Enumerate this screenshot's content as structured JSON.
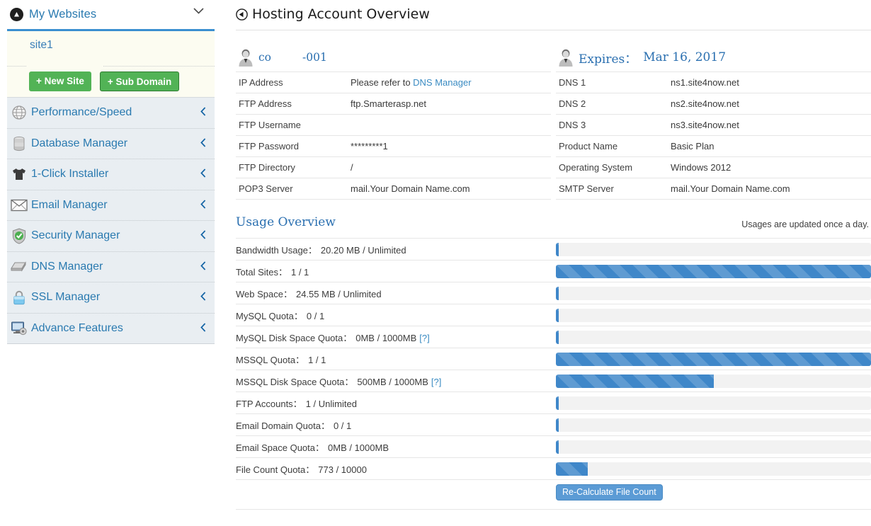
{
  "sidebar": {
    "header": {
      "title": "My Websites",
      "logo_icon": "triangle-circle-logo",
      "collapse_icon": "chevron-down-icon"
    },
    "site": {
      "name": "site1"
    },
    "buttons": [
      {
        "label": "+ New Site",
        "name": "new-site-button"
      },
      {
        "label": "+ Sub Domain",
        "name": "sub-domain-button"
      }
    ],
    "items": [
      {
        "label": "Performance/Speed",
        "icon": "globe-icon"
      },
      {
        "label": "Database Manager",
        "icon": "database-icon"
      },
      {
        "label": "1-Click Installer",
        "icon": "shirt-icon"
      },
      {
        "label": "Email Manager",
        "icon": "envelope-icon"
      },
      {
        "label": "Security Manager",
        "icon": "shield-check-icon"
      },
      {
        "label": "DNS Manager",
        "icon": "tray-icon"
      },
      {
        "label": "SSL Manager",
        "icon": "lock-icon"
      },
      {
        "label": "Advance Features",
        "icon": "monitor-gear-icon"
      }
    ],
    "caret_icon": "chevron-left-icon"
  },
  "main": {
    "page_title": "Hosting Account Overview",
    "back_icon": "circle-left-arrow-icon",
    "account": {
      "person_icon": "user-avatar-icon",
      "name_prefix": "co",
      "name_suffix": "-001"
    },
    "expires": {
      "person_icon": "user-avatar-icon",
      "label": "Expires：",
      "value": "Mar 16, 2017"
    },
    "left_table": [
      {
        "key": "IP Address",
        "value": "Please refer to ",
        "link": "DNS Manager"
      },
      {
        "key": "FTP Address",
        "value": "ftp.Smarterasp.net"
      },
      {
        "key": "FTP Username",
        "value": ""
      },
      {
        "key": "FTP Password",
        "value": "*********1"
      },
      {
        "key": "FTP Directory",
        "value": "/"
      },
      {
        "key": "POP3 Server",
        "value": "mail.Your Domain Name.com"
      }
    ],
    "right_table": [
      {
        "key": "DNS 1",
        "value": "ns1.site4now.net"
      },
      {
        "key": "DNS 2",
        "value": "ns2.site4now.net"
      },
      {
        "key": "DNS 3",
        "value": "ns3.site4now.net"
      },
      {
        "key": "Product Name",
        "value": "Basic Plan"
      },
      {
        "key": "Operating System",
        "value": "Windows 2012"
      },
      {
        "key": "SMTP Server",
        "value": "mail.Your Domain Name.com"
      }
    ],
    "usage": {
      "title": "Usage Overview",
      "note": "Usages are updated once a day.",
      "rows": [
        {
          "label": "Bandwidth Usage：",
          "value": "20.20 MB / Unlimited",
          "percent": 1,
          "help": ""
        },
        {
          "label": "Total Sites：",
          "value": "1 / 1",
          "percent": 100,
          "help": ""
        },
        {
          "label": "Web Space：",
          "value": "24.55 MB / Unlimited",
          "percent": 1,
          "help": ""
        },
        {
          "label": "MySQL Quota：",
          "value": "0 / 1",
          "percent": 1,
          "help": ""
        },
        {
          "label": "MySQL Disk Space Quota：",
          "value": "0MB / 1000MB",
          "percent": 1,
          "help": "[?]"
        },
        {
          "label": "MSSQL Quota：",
          "value": "1 / 1",
          "percent": 100,
          "help": ""
        },
        {
          "label": "MSSQL Disk Space Quota：",
          "value": "500MB / 1000MB",
          "percent": 50,
          "help": "[?]"
        },
        {
          "label": "FTP Accounts：",
          "value": "1 / Unlimited",
          "percent": 1,
          "help": ""
        },
        {
          "label": "Email Domain Quota：",
          "value": "0 / 1",
          "percent": 1,
          "help": ""
        },
        {
          "label": "Email Space Quota：",
          "value": "0MB / 1000MB",
          "percent": 1,
          "help": ""
        },
        {
          "label": "File Count Quota：",
          "value": "773 / 10000",
          "percent": 10,
          "help": ""
        }
      ],
      "recalc_label": "Re-Calculate File Count"
    }
  },
  "colors": {
    "accent_blue": "#2a7ab0",
    "bar_blue": "#3f87c9",
    "green": "#52b356",
    "sidebar_bg": "#e9eef2"
  }
}
